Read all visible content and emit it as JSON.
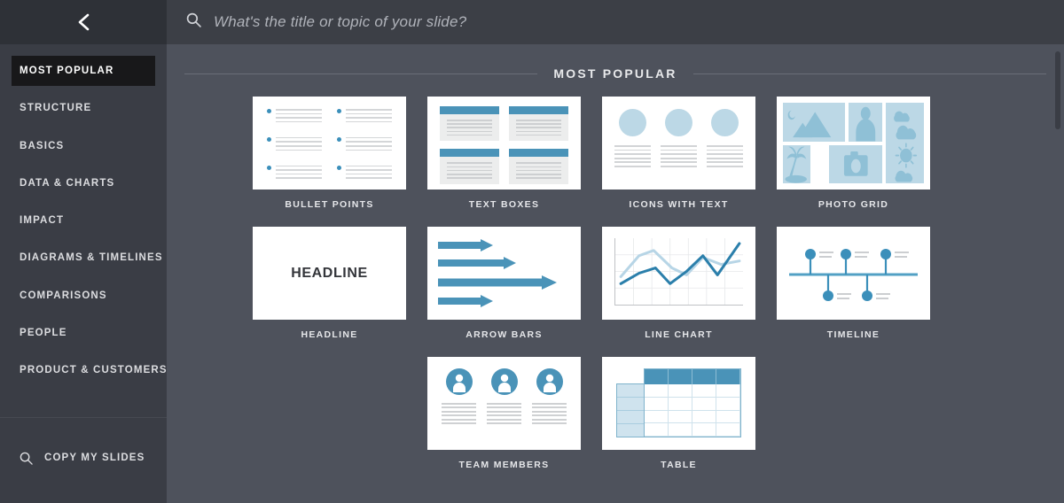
{
  "sidebar": {
    "back_icon": "chevron-left-icon",
    "items": [
      {
        "label": "MOST POPULAR",
        "active": true
      },
      {
        "label": "STRUCTURE",
        "active": false
      },
      {
        "label": "BASICS",
        "active": false
      },
      {
        "label": "DATA & CHARTS",
        "active": false
      },
      {
        "label": "IMPACT",
        "active": false
      },
      {
        "label": "DIAGRAMS & TIMELINES",
        "active": false
      },
      {
        "label": "COMPARISONS",
        "active": false
      },
      {
        "label": "PEOPLE",
        "active": false
      },
      {
        "label": "PRODUCT & CUSTOMERS",
        "active": false
      }
    ],
    "footer": {
      "icon": "search-icon",
      "label": "COPY MY SLIDES"
    }
  },
  "search": {
    "icon": "search-icon",
    "value": "",
    "placeholder": "What's the title or topic of your slide?"
  },
  "section": {
    "title": "MOST POPULAR"
  },
  "cards": [
    {
      "label": "BULLET POINTS",
      "kind": "bullet-points"
    },
    {
      "label": "TEXT BOXES",
      "kind": "text-boxes"
    },
    {
      "label": "ICONS WITH TEXT",
      "kind": "icons-with-text"
    },
    {
      "label": "PHOTO GRID",
      "kind": "photo-grid"
    },
    {
      "label": "HEADLINE",
      "kind": "headline"
    },
    {
      "label": "ARROW BARS",
      "kind": "arrow-bars"
    },
    {
      "label": "LINE CHART",
      "kind": "line-chart"
    },
    {
      "label": "TIMELINE",
      "kind": "timeline"
    },
    {
      "label": "TEAM MEMBERS",
      "kind": "team-members"
    },
    {
      "label": "TABLE",
      "kind": "table"
    }
  ],
  "thumbnails": {
    "headline_text": "HEADLINE",
    "photo_grid_icons": [
      "moon-mountains-icon",
      "person-icon",
      "clouds-icon",
      "palm-tree-icon",
      "camera-icon",
      "sun-icon"
    ]
  },
  "colors": {
    "sidebar_bg": "#3a3d45",
    "sidebar_top_bg": "#2e3137",
    "active_item_bg": "#18181a",
    "main_bg": "#4e525c",
    "searchbar_bg": "#3c3f46",
    "accent_blue": "#4a93b8",
    "light_blue": "#bcd8e6",
    "text_light": "#e6e7ea"
  },
  "scrollbar": {
    "orientation": "vertical",
    "position": "top"
  }
}
